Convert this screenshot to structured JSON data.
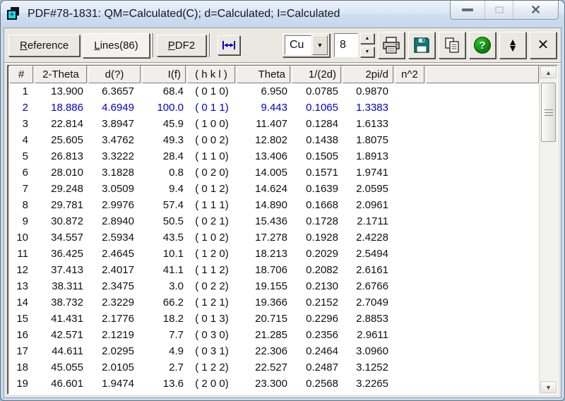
{
  "window": {
    "title": "PDF#78-1831: QM=Calculated(C); d=Calculated; I=Calculated"
  },
  "icons": {
    "combo_arrow": "▼",
    "spin_up": "▲",
    "spin_down": "▼",
    "sort_up": "▲",
    "sort_down": "▼",
    "help": "?",
    "toolbar_close": "✕",
    "caption_close": "✕",
    "scroll_up": "▲",
    "scroll_down": "▼",
    "window_badge": "+"
  },
  "toolbar": {
    "tabs": [
      {
        "accel": "R",
        "rest": "eference"
      },
      {
        "accel": "L",
        "rest": "ines(86)"
      },
      {
        "accel": "P",
        "rest": "DF2"
      }
    ],
    "active_tab": "Lines(86)",
    "anode_value": "Cu",
    "spin_value": "8"
  },
  "table": {
    "columns": [
      "#",
      "2-Theta",
      "d(?)",
      "I(f)",
      "( h k l )",
      "Theta",
      "1/(2d)",
      "2pi/d",
      "n^2",
      ""
    ],
    "highlight_row_index": 1,
    "highlight_color": "#0000cc",
    "rows": [
      [
        "1",
        "13.900",
        "6.3657",
        "68.4",
        "( 0 1 0)",
        "6.950",
        "0.0785",
        "0.9870"
      ],
      [
        "2",
        "18.886",
        "4.6949",
        "100.0",
        "( 0 1 1)",
        "9.443",
        "0.1065",
        "1.3383"
      ],
      [
        "3",
        "22.814",
        "3.8947",
        "45.9",
        "( 1 0 0)",
        "11.407",
        "0.1284",
        "1.6133"
      ],
      [
        "4",
        "25.605",
        "3.4762",
        "49.3",
        "( 0 0 2)",
        "12.802",
        "0.1438",
        "1.8075"
      ],
      [
        "5",
        "26.813",
        "3.3222",
        "28.4",
        "( 1 1 0)",
        "13.406",
        "0.1505",
        "1.8913"
      ],
      [
        "6",
        "28.010",
        "3.1828",
        "0.8",
        "( 0 2 0)",
        "14.005",
        "0.1571",
        "1.9741"
      ],
      [
        "7",
        "29.248",
        "3.0509",
        "9.4",
        "( 0 1 2)",
        "14.624",
        "0.1639",
        "2.0595"
      ],
      [
        "8",
        "29.781",
        "2.9976",
        "57.4",
        "( 1 1 1)",
        "14.890",
        "0.1668",
        "2.0961"
      ],
      [
        "9",
        "30.872",
        "2.8940",
        "50.5",
        "( 0 2 1)",
        "15.436",
        "0.1728",
        "2.1711"
      ],
      [
        "10",
        "34.557",
        "2.5934",
        "43.5",
        "( 1 0 2)",
        "17.278",
        "0.1928",
        "2.4228"
      ],
      [
        "11",
        "36.425",
        "2.4645",
        "10.1",
        "( 1 2 0)",
        "18.213",
        "0.2029",
        "2.5494"
      ],
      [
        "12",
        "37.413",
        "2.4017",
        "41.1",
        "( 1 1 2)",
        "18.706",
        "0.2082",
        "2.6161"
      ],
      [
        "13",
        "38.311",
        "2.3475",
        "3.0",
        "( 0 2 2)",
        "19.155",
        "0.2130",
        "2.6766"
      ],
      [
        "14",
        "38.732",
        "2.3229",
        "66.2",
        "( 1 2 1)",
        "19.366",
        "0.2152",
        "2.7049"
      ],
      [
        "15",
        "41.431",
        "2.1776",
        "18.2",
        "( 0 1 3)",
        "20.715",
        "0.2296",
        "2.8853"
      ],
      [
        "16",
        "42.571",
        "2.1219",
        "7.7",
        "( 0 3 0)",
        "21.285",
        "0.2356",
        "2.9611"
      ],
      [
        "17",
        "44.611",
        "2.0295",
        "4.9",
        "( 0 3 1)",
        "22.306",
        "0.2464",
        "3.0960"
      ],
      [
        "18",
        "45.055",
        "2.0105",
        "2.7",
        "( 1 2 2)",
        "22.527",
        "0.2487",
        "3.1252"
      ],
      [
        "19",
        "46.601",
        "1.9474",
        "13.6",
        "( 2 0 0)",
        "23.300",
        "0.2568",
        "3.2265"
      ]
    ]
  }
}
